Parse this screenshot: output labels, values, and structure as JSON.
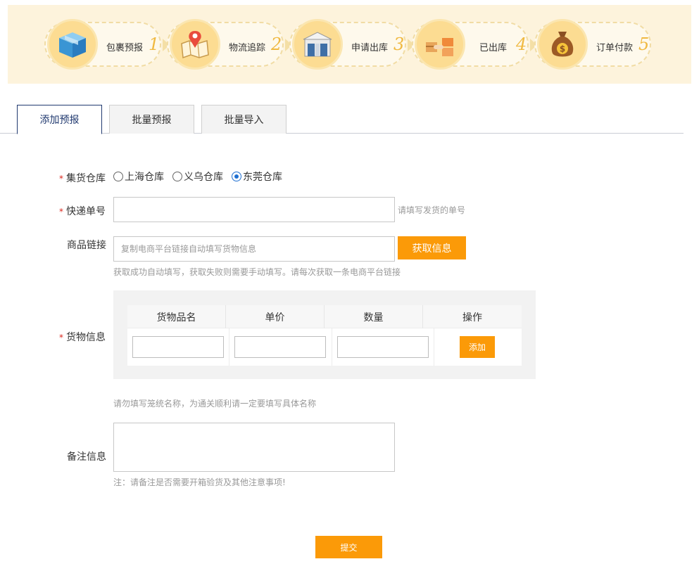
{
  "steps": [
    {
      "label": "包裹预报",
      "num": "1",
      "icon": "package-box-icon"
    },
    {
      "label": "物流追踪",
      "num": "2",
      "icon": "map-pin-icon"
    },
    {
      "label": "申请出库",
      "num": "3",
      "icon": "warehouse-icon"
    },
    {
      "label": "已出库",
      "num": "4",
      "icon": "boxes-handoff-icon"
    },
    {
      "label": "订单付款",
      "num": "5",
      "icon": "money-bag-icon"
    }
  ],
  "tabs": {
    "add": "添加预报",
    "batch": "批量预报",
    "import": "批量导入"
  },
  "form": {
    "required_mark": "*",
    "warehouse": {
      "label": "集货仓库",
      "options": [
        "上海仓库",
        "义乌仓库",
        "东莞仓库"
      ],
      "selected": "东莞仓库"
    },
    "tracking": {
      "label": "快递单号",
      "value": "",
      "hint": "请填写发货的单号"
    },
    "link": {
      "label": "商品链接",
      "placeholder": "复制电商平台链接自动填写货物信息",
      "button": "获取信息",
      "hint": "获取成功自动填写，获取失败则需要手动填写。请每次获取一条电商平台链接"
    },
    "goods": {
      "label": "货物信息",
      "columns": [
        "货物品名",
        "单价",
        "数量",
        "操作"
      ],
      "add_button": "添加",
      "hint": "请勿填写笼统名称，为通关顺利请一定要填写具体名称"
    },
    "remark": {
      "label": "备注信息",
      "hint": "注：请备注是否需要开箱验货及其他注意事项!"
    },
    "submit": "提交"
  },
  "colors": {
    "accent": "#fb9a08",
    "banner_bg": "#fdf3dc",
    "step_circle": "#fcdc92",
    "step_number": "#f0b941",
    "tab_active": "#20396f",
    "required": "#d9261c",
    "radio_checked": "#1f6fd1"
  }
}
